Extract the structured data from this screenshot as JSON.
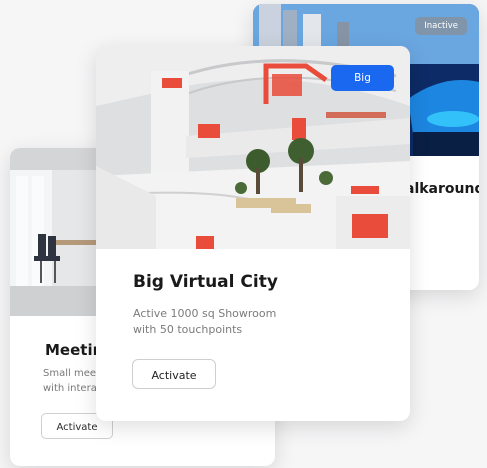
{
  "cards": {
    "walkaround": {
      "status_badge": "Inactive",
      "title": "alkaround"
    },
    "meeting": {
      "title": "Meetin",
      "description_lines": [
        "Small mee",
        "with intera"
      ],
      "button_label": "Activate"
    },
    "big_city": {
      "size_badge": "Big",
      "title": "Big Virtual City",
      "description_lines": [
        "Active 1000 sq Showroom",
        "with 50 touchpoints"
      ],
      "button_label": "Activate"
    }
  },
  "colors": {
    "accent_blue": "#1a67f0",
    "brand_red": "#e94c3a",
    "card_background": "#ffffff",
    "page_background": "#f6f6f7"
  }
}
